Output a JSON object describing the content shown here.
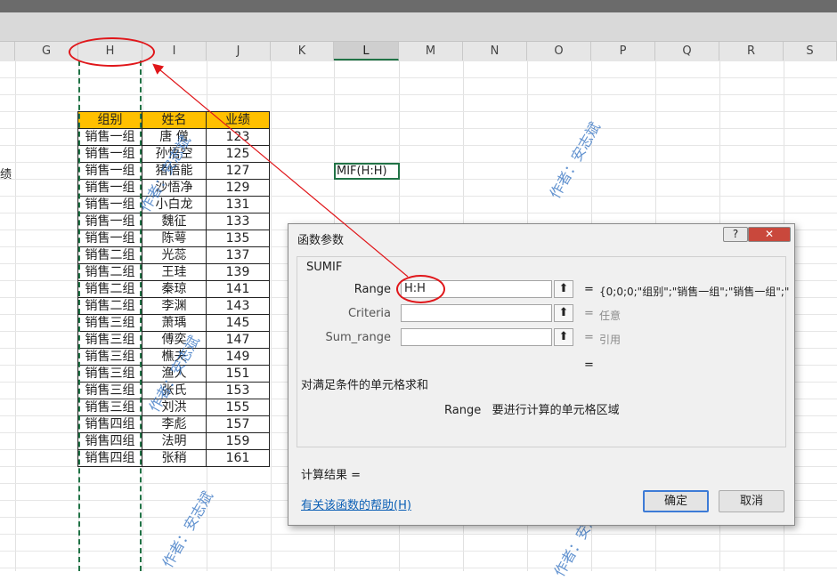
{
  "columns": [
    "G",
    "H",
    "I",
    "J",
    "K",
    "L",
    "M",
    "N",
    "O",
    "P",
    "Q",
    "R",
    "S"
  ],
  "selected_column": "L",
  "left_fragment": "绩",
  "table": {
    "headers": [
      "组别",
      "姓名",
      "业绩"
    ],
    "rows": [
      [
        "销售一组",
        "唐 僧",
        "123"
      ],
      [
        "销售一组",
        "孙悟空",
        "125"
      ],
      [
        "销售一组",
        "猪悟能",
        "127"
      ],
      [
        "销售一组",
        "沙悟净",
        "129"
      ],
      [
        "销售一组",
        "小白龙",
        "131"
      ],
      [
        "销售一组",
        "魏征",
        "133"
      ],
      [
        "销售一组",
        "陈萼",
        "135"
      ],
      [
        "销售二组",
        "光蕊",
        "137"
      ],
      [
        "销售二组",
        "王珪",
        "139"
      ],
      [
        "销售二组",
        "秦琼",
        "141"
      ],
      [
        "销售二组",
        "李渊",
        "143"
      ],
      [
        "销售三组",
        "萧瑀",
        "145"
      ],
      [
        "销售三组",
        "傅奕",
        "147"
      ],
      [
        "销售三组",
        "樵夫",
        "149"
      ],
      [
        "销售三组",
        "渔人",
        "151"
      ],
      [
        "销售三组",
        "张氏",
        "153"
      ],
      [
        "销售三组",
        "刘洪",
        "155"
      ],
      [
        "销售四组",
        "李彪",
        "157"
      ],
      [
        "销售四组",
        "法明",
        "159"
      ],
      [
        "销售四组",
        "张稍",
        "161"
      ]
    ]
  },
  "edited_cell_text": "MIF(H:H)",
  "watermark_text": "作者：安志斌",
  "dialog": {
    "title": "函数参数",
    "help_btn": "?",
    "close_btn": "✕",
    "function_name": "SUMIF",
    "args": [
      {
        "label": "Range",
        "value": "H:H",
        "result": "{0;0;0;\"组别\";\"销售一组\";\"销售一组\";\"",
        "gray": false
      },
      {
        "label": "Criteria",
        "value": "",
        "result": "任意",
        "gray": true
      },
      {
        "label": "Sum_range",
        "value": "",
        "result": "引用",
        "gray": true
      }
    ],
    "ref_icon": "⬆",
    "equals": "=",
    "description": "对满足条件的单元格求和",
    "arg_desc_name": "Range",
    "arg_desc_text": "要进行计算的单元格区域",
    "result_label": "计算结果 =",
    "help_link": "有关该函数的帮助(H)",
    "ok": "确定",
    "cancel": "取消"
  },
  "colors": {
    "header_fill": "#ffc000",
    "accent_green": "#217346",
    "annotation_red": "#e0161a",
    "watermark": "#3b78c4"
  }
}
